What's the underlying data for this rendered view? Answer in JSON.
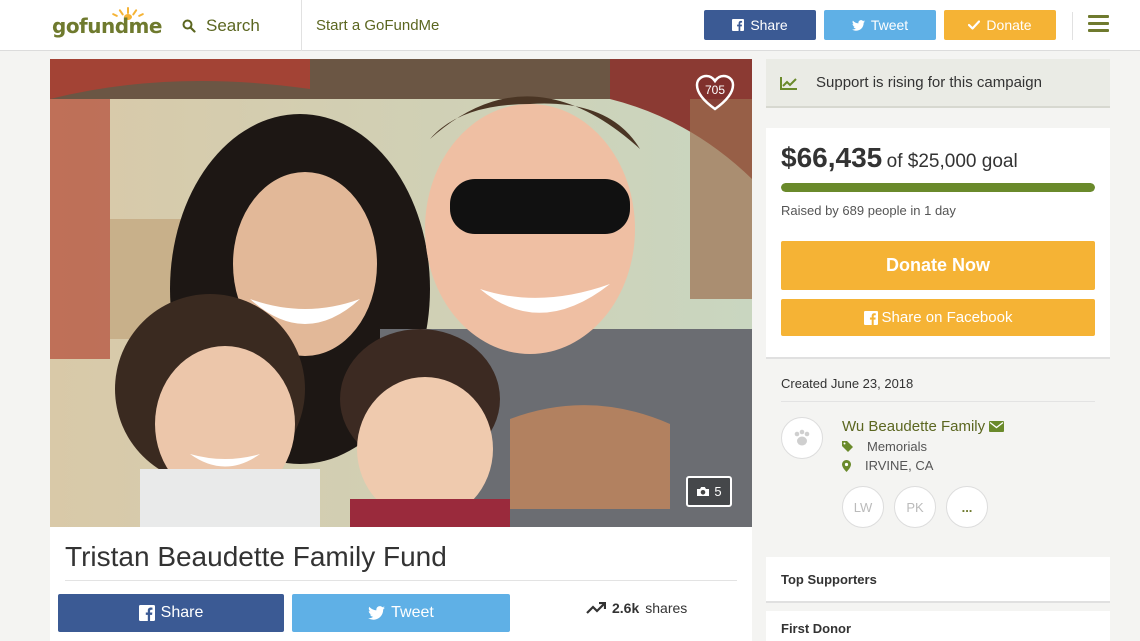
{
  "header": {
    "logo_text": "gofundme",
    "search_label": "Search",
    "start_label": "Start a GoFundMe",
    "share_label": "Share",
    "tweet_label": "Tweet",
    "donate_label": "Donate",
    "colors": {
      "brand": "#6f7a2e",
      "facebook": "#3b5a94",
      "twitter": "#5fb0e6",
      "donate": "#f5b335"
    }
  },
  "photo": {
    "heart_count": "705",
    "photo_count": "5"
  },
  "campaign": {
    "title": "Tristan Beaudette Family Fund",
    "share_label": "Share",
    "tweet_label": "Tweet",
    "shares_count": "2.6k",
    "shares_label": "shares"
  },
  "sidebar": {
    "rising_text": "Support is rising for this campaign",
    "raised_amount": "$66,435",
    "goal_text": "of $25,000 goal",
    "progress_fraction": 1.0,
    "raised_by": "Raised by 689 people in 1 day",
    "donate_now_label": "Donate Now",
    "share_facebook_label": "Share on Facebook",
    "created": "Created June 23, 2018",
    "organizer_name": "Wu Beaudette Family",
    "category": "Memorials",
    "location": "IRVINE, CA",
    "donor_initials": [
      "LW",
      "PK"
    ],
    "more_label": "...",
    "top_supporters_label": "Top Supporters",
    "first_donor_label": "First Donor"
  }
}
